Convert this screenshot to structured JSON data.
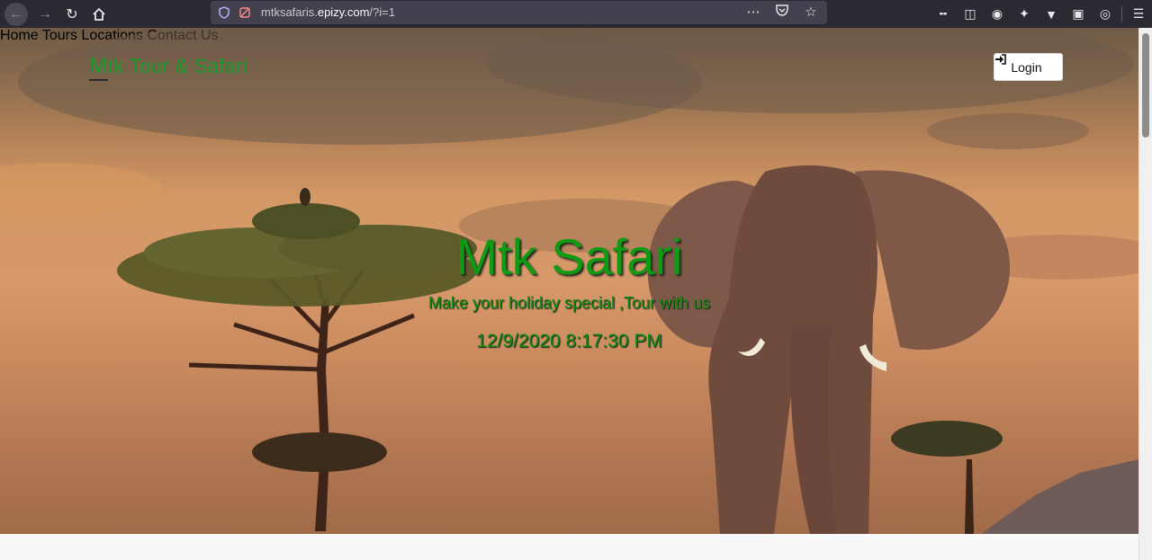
{
  "browser": {
    "url_prefix": "mtksafaris.",
    "url_domain": "epizy.com",
    "url_path": "/?i=1",
    "back_icon": "arrow-left-icon",
    "forward_icon": "arrow-right-icon",
    "reload_icon": "reload-icon",
    "home_icon": "home-icon",
    "page_actions_icon": "more-horizontal-icon",
    "pocket_icon": "pocket-icon",
    "bookmark_icon": "star-icon",
    "toolbar_icons": [
      "library-icon",
      "sidebar-icon",
      "account-icon",
      "extension-icon",
      "vpn-icon",
      "picture-icon",
      "globe-icon",
      "menu-icon"
    ]
  },
  "site": {
    "brand_first": "M",
    "brand_rest": "tk Tour & Safari",
    "nav": [
      "Home",
      "Tours",
      "Locations",
      "Contact Us"
    ],
    "login_label": "Login",
    "login_icon": "sign-in-icon",
    "brand_color": "#1a9a2a"
  },
  "hero": {
    "title": "Mtk Safari",
    "subtitle": "Make your holiday special ,Tour with us",
    "datetime": "12/9/2020 8:17:30 PM",
    "accent_color": "#0f9b12"
  }
}
